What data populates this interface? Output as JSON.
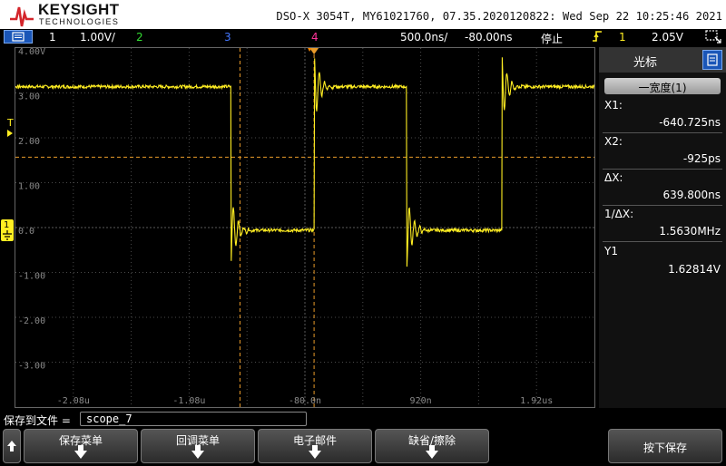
{
  "header": {
    "brand": "KEYSIGHT",
    "brand_sub": "TECHNOLOGIES",
    "title": "DSO-X 3054T, MY61021760, 07.35.2020120822: Wed Sep 22 10:25:46 2021"
  },
  "status_bar": {
    "ch1_label": "1",
    "ch1_scale": "1.00V/",
    "ch2_label": "2",
    "ch3_label": "3",
    "ch4_label": "4",
    "timebase": "500.0ns/",
    "delay": "-80.00ns",
    "run_state": "停止",
    "trigger_channel": "1",
    "trigger_level": "2.05V",
    "colors": {
      "ch1": "#ffff33",
      "ch2": "#33dd33",
      "ch3": "#4477ff",
      "ch4": "#ff3399"
    }
  },
  "plot": {
    "y_tick_labels": [
      "4.00V",
      "3.00",
      "2.00",
      "1.00",
      "0.0",
      "-1.00",
      "-2.00",
      "-3.00"
    ],
    "x_tick_labels": [
      "-2.08u",
      "-1.08u",
      "-80.0n",
      "920n",
      "1.92us"
    ],
    "trigger_marker": "T",
    "ground_marker": "1",
    "trace_color": "#ffee22",
    "cursor_color": "#e89a2a",
    "waveform_levels_V": {
      "high": 3.2,
      "low": 0.0
    },
    "waveform_edges_us": [
      {
        "time": -0.72,
        "edge": "falling"
      },
      {
        "time": 0.0,
        "edge": "rising"
      },
      {
        "time": 0.8,
        "edge": "falling"
      },
      {
        "time": 1.62,
        "edge": "rising"
      }
    ]
  },
  "side_panel": {
    "title": "光标",
    "mode_button": "一宽度(1)",
    "x1_label": "X1:",
    "x1_value": "-640.725ns",
    "x2_label": "X2:",
    "x2_value": "-925ps",
    "dx_label": "ΔX:",
    "dx_value": "639.800ns",
    "inv_dx_label": "1/ΔX:",
    "inv_dx_value": "1.5630MHz",
    "y1_label": "Y1",
    "y1_value": "1.62814V"
  },
  "save_row": {
    "label": "保存到文件 =",
    "filename": "scope_7"
  },
  "softkeys": {
    "save_menu": "保存菜单",
    "recall_menu": "回调菜单",
    "email": "电子邮件",
    "default_erase": "缺省/擦除",
    "press_to_save": "按下保存"
  }
}
